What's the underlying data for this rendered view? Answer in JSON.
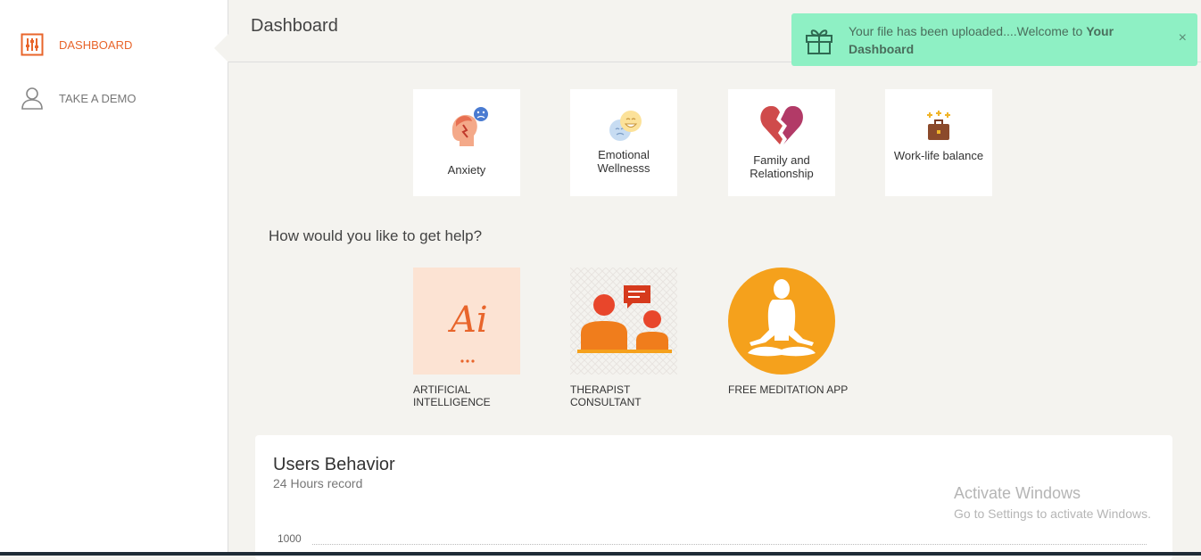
{
  "sidebar": {
    "items": [
      {
        "label": "DASHBOARD",
        "icon": "sliders-icon",
        "active": true
      },
      {
        "label": "TAKE A DEMO",
        "icon": "user-icon",
        "active": false
      }
    ]
  },
  "header": {
    "title": "Dashboard"
  },
  "toast": {
    "message_prefix": "Your file has been uploaded....Welcome to ",
    "message_bold": "Your Dashboard",
    "icon": "gift-icon",
    "close": "×",
    "background": "#8ef0c4"
  },
  "categories": [
    {
      "label": "Anxiety",
      "icon": "anxiety-head-icon"
    },
    {
      "label": "Emotional Wellnesss",
      "icon": "emotional-faces-icon"
    },
    {
      "label": "Family and Relationship",
      "icon": "broken-heart-icon"
    },
    {
      "label": "Work-life balance",
      "icon": "briefcase-icon"
    }
  ],
  "help": {
    "title": "How would you like to get help?",
    "options": [
      {
        "label": "ARTIFICIAL INTELLIGENCE",
        "icon": "ai-logo-icon",
        "logo_text": "Ai"
      },
      {
        "label": "THERAPIST CONSULTANT",
        "icon": "therapist-icon"
      },
      {
        "label": "FREE MEDITATION APP",
        "icon": "meditation-icon"
      }
    ]
  },
  "chart_panel": {
    "title": "Users Behavior",
    "subtitle": "24 Hours record",
    "y_tick": "1000"
  },
  "watermark": {
    "line1": "Activate Windows",
    "line2": "Go to Settings to activate Windows."
  },
  "colors": {
    "accent": "#e8652b",
    "background": "#f4f3ef",
    "toast": "#8ef0c4",
    "meditation": "#f5a11c"
  }
}
